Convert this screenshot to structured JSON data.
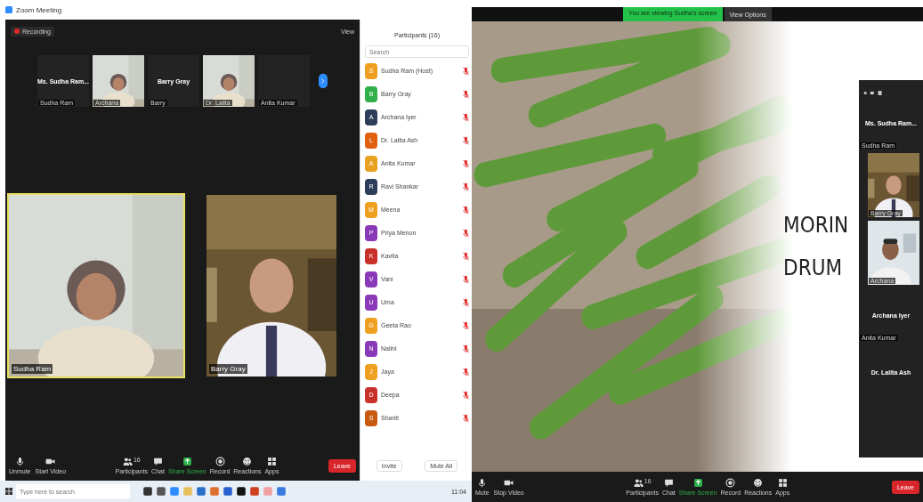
{
  "left_window": {
    "title": "Zoom Meeting",
    "top_bar": {
      "recording_label": "Recording",
      "view_button": "View"
    },
    "gallery_strip": [
      {
        "kind": "name",
        "name": "Ms. Sudha Ram...",
        "caption": "Sudha Ram"
      },
      {
        "kind": "video",
        "caption": "Archana"
      },
      {
        "kind": "name",
        "name": "Barry Gray",
        "caption": "Barry"
      },
      {
        "kind": "video",
        "caption": "Dr. Lalita"
      },
      {
        "kind": "name",
        "caption": "Anita Kumar"
      }
    ],
    "main_videos": [
      {
        "name": "Sudha Ram",
        "active": true
      },
      {
        "name": "Barry Gray",
        "active": false
      }
    ],
    "toolbar": [
      {
        "label": "Unmute"
      },
      {
        "label": "Start Video"
      },
      {
        "label": "Participants",
        "count": "16"
      },
      {
        "label": "Chat"
      },
      {
        "label": "Share Screen"
      },
      {
        "label": "Record"
      },
      {
        "label": "Reactions"
      },
      {
        "label": "Apps"
      }
    ],
    "leave_button": "Leave",
    "participants": {
      "title": "Participants (16)",
      "search_placeholder": "Search",
      "list": [
        {
          "initial": "S",
          "name": "Sudha Ram (Host)",
          "color": "#f0a020",
          "muted": true
        },
        {
          "initial": "B",
          "name": "Barry Gray",
          "color": "#2fb04a",
          "muted": true
        },
        {
          "initial": "A",
          "name": "Archana Iyer",
          "color": "#2c3e5a",
          "muted": true
        },
        {
          "initial": "L",
          "name": "Dr. Lalita Ash",
          "color": "#e06010",
          "muted": true
        },
        {
          "initial": "A",
          "name": "Anita Kumar",
          "color": "#e8a020",
          "muted": true
        },
        {
          "initial": "R",
          "name": "Ravi Shankar",
          "color": "#2c3e5a",
          "muted": true
        },
        {
          "initial": "M",
          "name": "Meena",
          "color": "#f0a020",
          "muted": true
        },
        {
          "initial": "P",
          "name": "Priya Menon",
          "color": "#8a3ab9",
          "muted": true
        },
        {
          "initial": "K",
          "name": "Kavita",
          "color": "#c8302a",
          "muted": true
        },
        {
          "initial": "V",
          "name": "Vani",
          "color": "#8a3ab9",
          "muted": true
        },
        {
          "initial": "U",
          "name": "Uma",
          "color": "#8a3ab9",
          "muted": true
        },
        {
          "initial": "G",
          "name": "Geeta Rao",
          "color": "#f0a020",
          "muted": true
        },
        {
          "initial": "N",
          "name": "Nalini",
          "color": "#8a3ab9",
          "muted": true
        },
        {
          "initial": "J",
          "name": "Jaya",
          "color": "#f0a020",
          "muted": true
        },
        {
          "initial": "D",
          "name": "Deepa",
          "color": "#c8302a",
          "muted": true
        },
        {
          "initial": "S",
          "name": "Shanti",
          "color": "#c85a10",
          "muted": true
        }
      ],
      "buttons": [
        "Invite",
        "Mute All"
      ]
    }
  },
  "taskbar": {
    "search_placeholder": "Type here to search",
    "time": "11:04"
  },
  "right_window": {
    "banner": "You are viewing Sudha's screen",
    "view_options": "View Options",
    "slide": {
      "lines": [
        "MORIN",
        "DRUM"
      ]
    },
    "side_panel": [
      {
        "kind": "name",
        "name": "Ms. Sudha Ram...",
        "caption": "Sudha Ram"
      },
      {
        "kind": "video",
        "caption": "Barry Gray"
      },
      {
        "kind": "video",
        "caption": "Archana"
      },
      {
        "kind": "name",
        "name": "Archana Iyer",
        "caption": "Anita Kumar"
      },
      {
        "kind": "name",
        "name": "Dr. Lalita Ash"
      }
    ],
    "toolbar": [
      {
        "label": "Mute"
      },
      {
        "label": "Stop Video"
      },
      {
        "label": "Participants",
        "count": "16"
      },
      {
        "label": "Chat"
      },
      {
        "label": "Share Screen"
      },
      {
        "label": "Record"
      },
      {
        "label": "Reactions"
      },
      {
        "label": "Apps"
      }
    ],
    "leave_button": "Leave"
  }
}
